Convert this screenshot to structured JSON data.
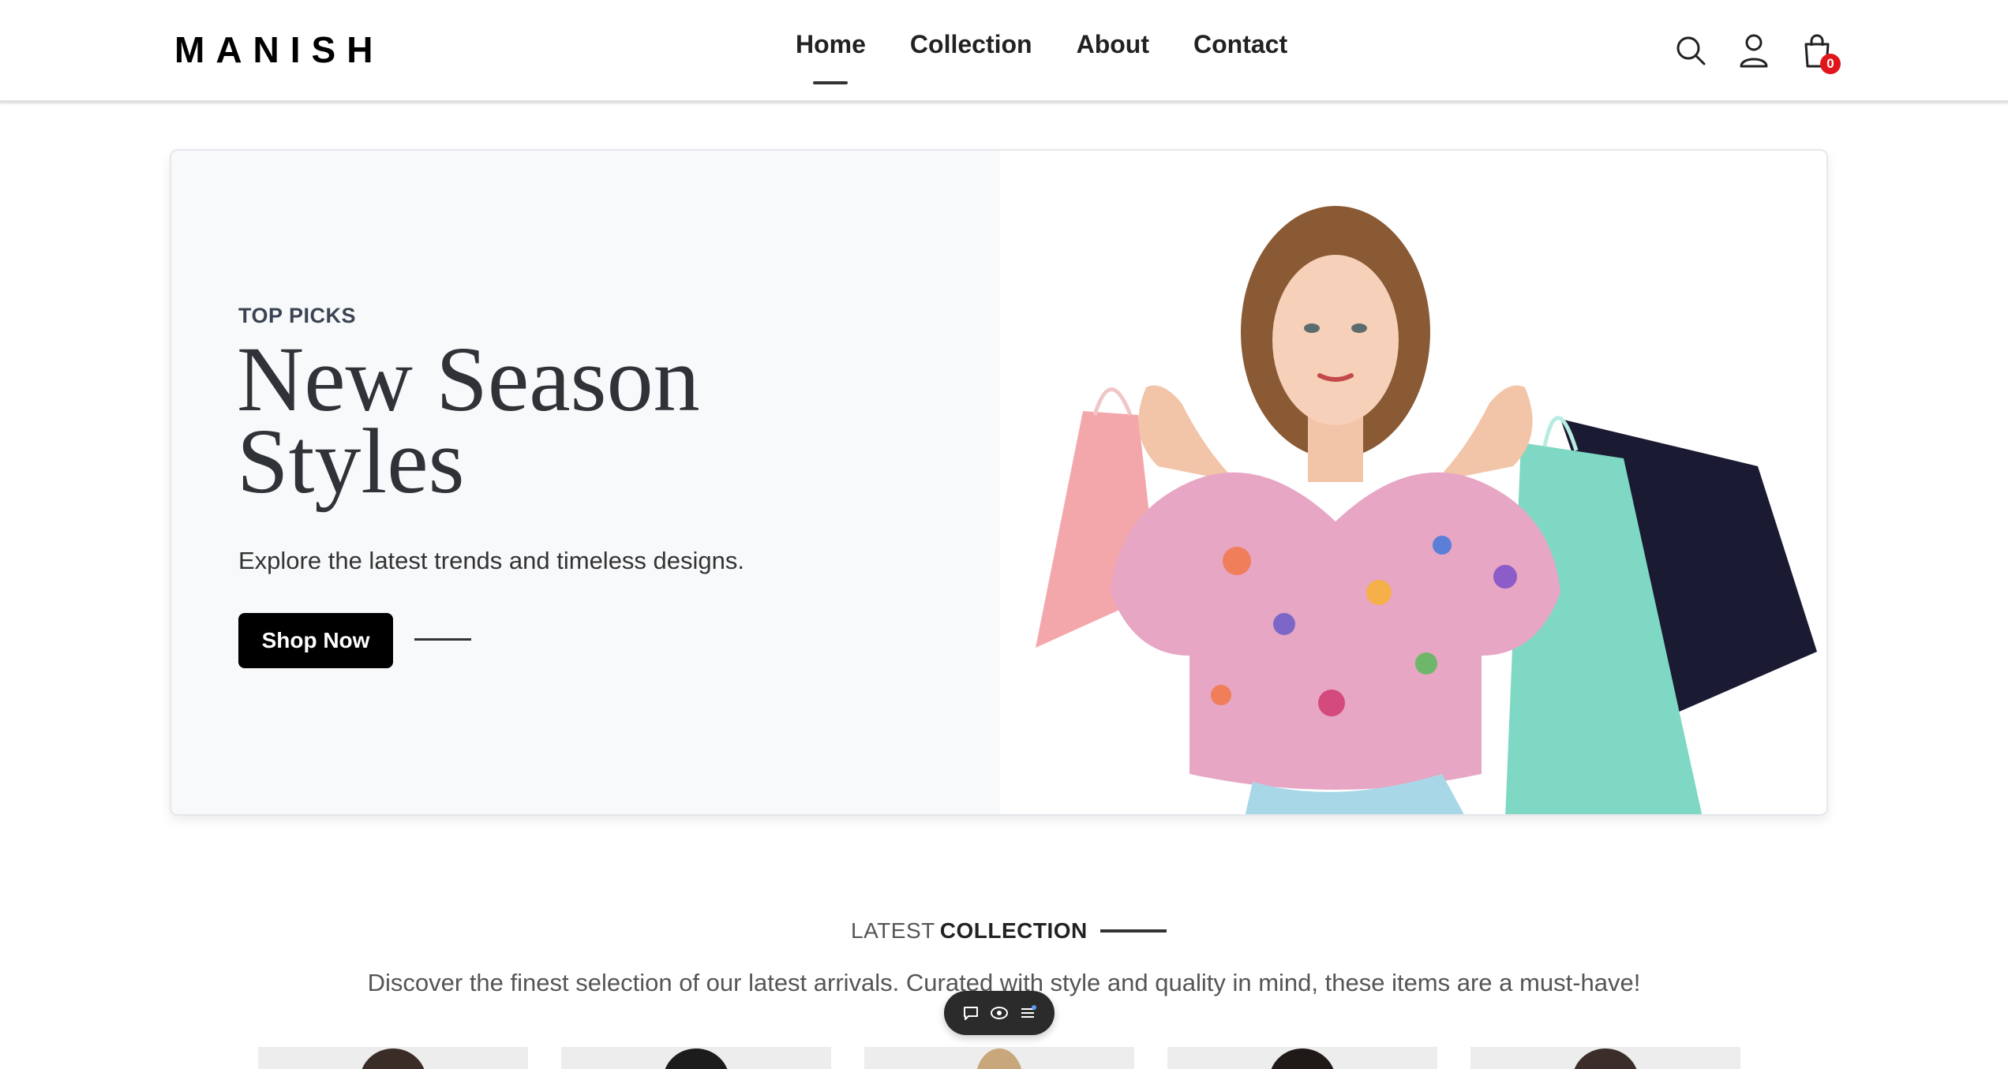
{
  "brand": {
    "logo": "MANISH"
  },
  "nav": {
    "items": [
      "Home",
      "Collection",
      "About",
      "Contact"
    ],
    "active": "Home"
  },
  "header_icons": {
    "search": "search-icon",
    "account": "user-icon",
    "cart": "shopping-bag-icon",
    "cart_count": "0"
  },
  "hero": {
    "eyebrow": "TOP PICKS",
    "headline": "New Season Styles",
    "subtext": "Explore the latest trends and timeless designs.",
    "cta_label": "Shop Now"
  },
  "latest": {
    "title_light": "LATEST",
    "title_bold": "COLLECTION",
    "description": "Discover the finest selection of our latest arrivals. Curated with style and quality in mind, these items are a must-have!"
  },
  "floating_toolbar": {
    "icons": [
      "chat-bubble-icon",
      "eye-icon",
      "list-icon"
    ]
  },
  "colors": {
    "badge": "#e0161b",
    "cta": "#000000",
    "hero_left_bg": "#f8f9fb"
  }
}
